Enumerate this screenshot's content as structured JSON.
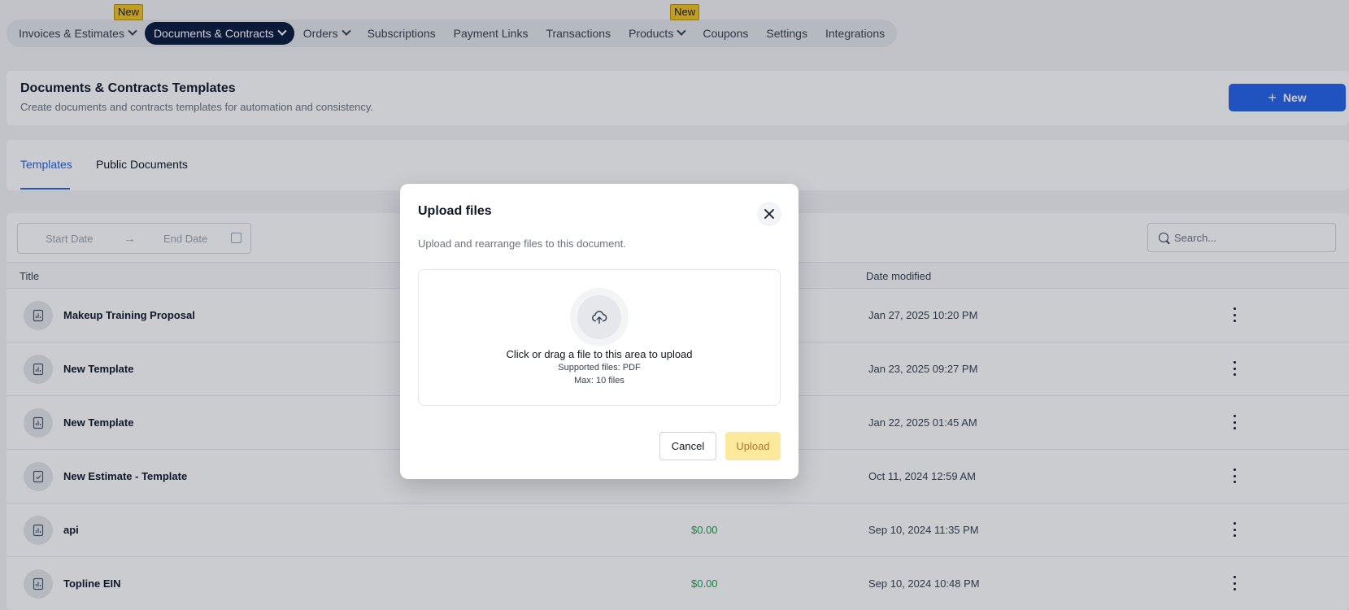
{
  "nav": {
    "items": [
      {
        "label": "Invoices & Estimates",
        "has_dropdown": true,
        "badge": "New"
      },
      {
        "label": "Documents & Contracts",
        "has_dropdown": true,
        "active": true
      },
      {
        "label": "Orders",
        "has_dropdown": true
      },
      {
        "label": "Subscriptions"
      },
      {
        "label": "Payment Links"
      },
      {
        "label": "Transactions"
      },
      {
        "label": "Products",
        "has_dropdown": true,
        "badge": "New"
      },
      {
        "label": "Coupons"
      },
      {
        "label": "Settings"
      },
      {
        "label": "Integrations"
      }
    ]
  },
  "header": {
    "title": "Documents & Contracts Templates",
    "subtitle": "Create documents and contracts templates for automation and consistency.",
    "new_button": "New"
  },
  "tabs": [
    {
      "label": "Templates",
      "active": true
    },
    {
      "label": "Public Documents"
    }
  ],
  "filters": {
    "start_date_placeholder": "Start Date",
    "end_date_placeholder": "End Date",
    "search_placeholder": "Search..."
  },
  "table": {
    "columns": {
      "title": "Title",
      "date_modified": "Date modified"
    },
    "rows": [
      {
        "title": "Makeup Training Proposal",
        "amount": "",
        "date": "Jan 27, 2025 10:20 PM",
        "icon": "chart-document-icon"
      },
      {
        "title": "New Template",
        "amount": "",
        "date": "Jan 23, 2025 09:27 PM",
        "icon": "chart-document-icon"
      },
      {
        "title": "New Template",
        "amount": "",
        "date": "Jan 22, 2025 01:45 AM",
        "icon": "chart-document-icon"
      },
      {
        "title": "New Estimate - Template",
        "amount": "",
        "date": "Oct 11, 2024 12:59 AM",
        "icon": "check-document-icon"
      },
      {
        "title": "api",
        "amount": "$0.00",
        "date": "Sep 10, 2024 11:35 PM",
        "icon": "chart-document-icon"
      },
      {
        "title": "Topline EIN",
        "amount": "$0.00",
        "date": "Sep 10, 2024 10:48 PM",
        "icon": "chart-document-icon"
      }
    ]
  },
  "modal": {
    "title": "Upload files",
    "description": "Upload and rearrange files to this document.",
    "dropzone_text": "Click or drag a file to this area to upload",
    "supported_files": "Supported files: PDF",
    "max_files": "Max: 10 files",
    "cancel_label": "Cancel",
    "upload_label": "Upload"
  },
  "colors": {
    "accent_blue": "#2563eb",
    "nav_active": "#0b1b3f",
    "badge_yellow": "#f5c518",
    "amount_green": "#16a34a",
    "upload_disabled": "#fde68a"
  }
}
